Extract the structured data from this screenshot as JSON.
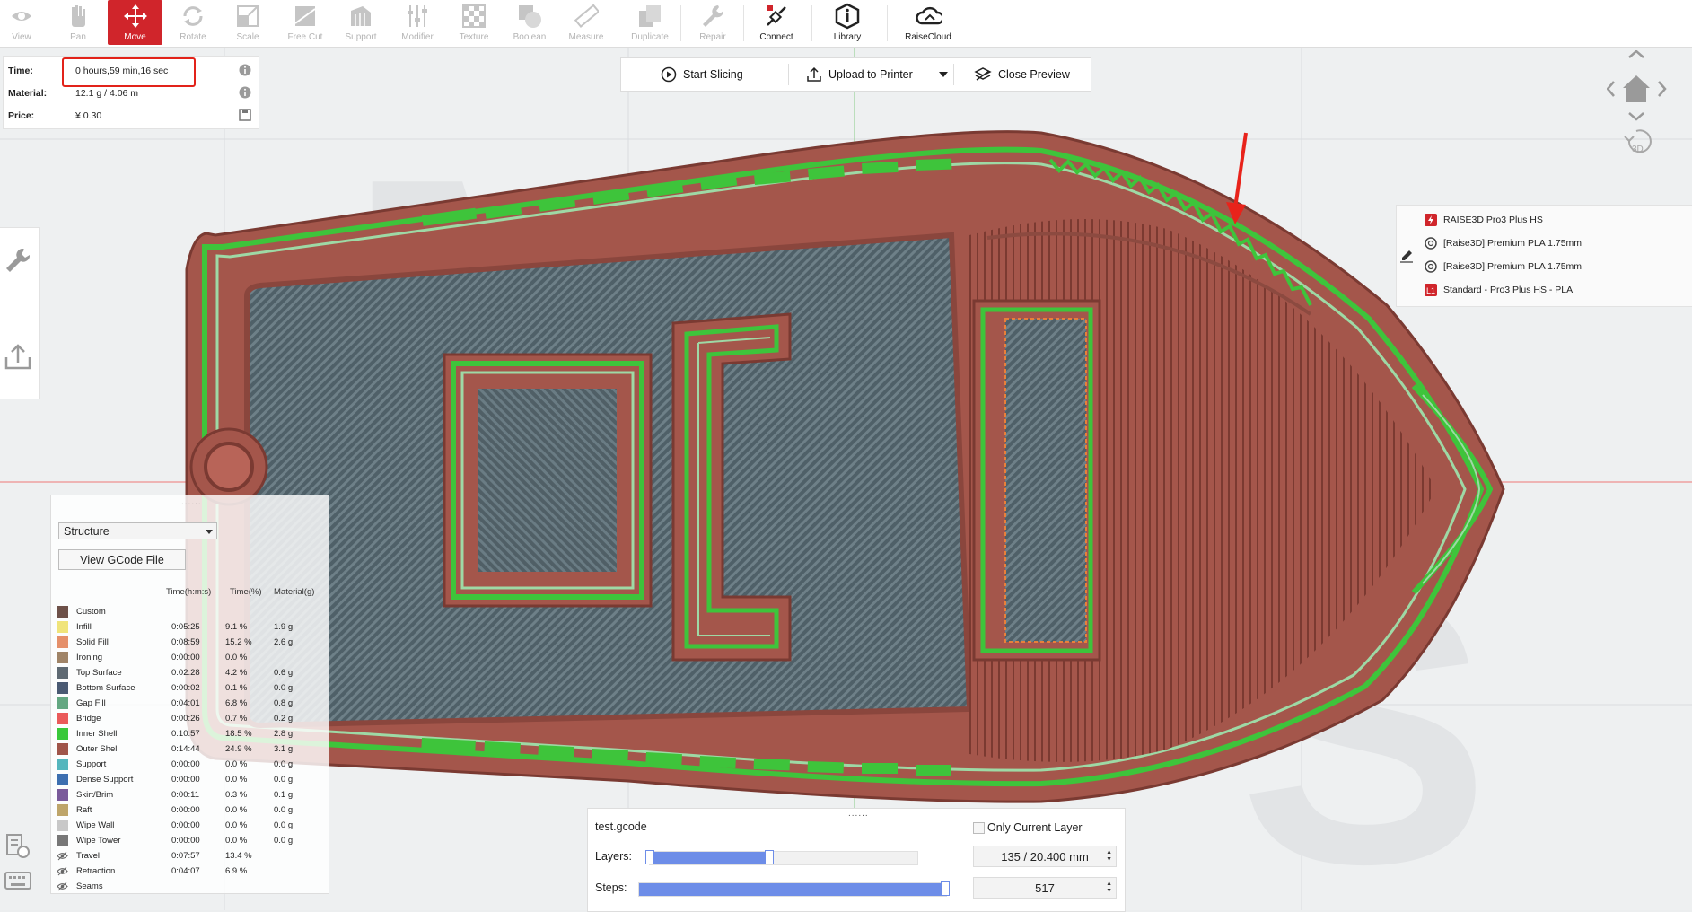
{
  "toolbar": {
    "items": [
      {
        "label": "View",
        "icon": "eye-icon"
      },
      {
        "label": "Pan",
        "icon": "hand-icon"
      },
      {
        "label": "Move",
        "icon": "move-icon"
      },
      {
        "label": "Rotate",
        "icon": "rotate-icon"
      },
      {
        "label": "Scale",
        "icon": "scale-icon"
      },
      {
        "label": "Free Cut",
        "icon": "free-cut-icon"
      },
      {
        "label": "Support",
        "icon": "support-icon"
      },
      {
        "label": "Modifier",
        "icon": "modifier-icon"
      },
      {
        "label": "Texture",
        "icon": "texture-icon"
      },
      {
        "label": "Boolean",
        "icon": "boolean-icon"
      },
      {
        "label": "Measure",
        "icon": "measure-icon"
      },
      {
        "label": "Duplicate",
        "icon": "duplicate-icon"
      },
      {
        "label": "Repair",
        "icon": "repair-icon"
      },
      {
        "label": "Connect",
        "icon": "connect-icon"
      },
      {
        "label": "Library",
        "icon": "library-icon"
      },
      {
        "label": "RaiseCloud",
        "icon": "cloud-icon"
      }
    ],
    "active": "Move",
    "active_color": "#d0252b"
  },
  "info": {
    "time_label": "Time:",
    "time_value": "0 hours,59 min,16 sec",
    "material_label": "Material:",
    "material_value": "12.1 g / 4.06 m",
    "price_label": "Price:",
    "price_value": "¥ 0.30"
  },
  "actions": {
    "start_slicing": "Start Slicing",
    "upload": "Upload to Printer",
    "close_preview": "Close Preview"
  },
  "machine": {
    "printer": "RAISE3D Pro3 Plus HS",
    "filament_left": "[Raise3D] Premium PLA 1.75mm",
    "filament_right": "[Raise3D] Premium PLA 1.75mm",
    "profile": "Standard - Pro3 Plus HS - PLA",
    "profile_badge": "L1"
  },
  "view_nav": {
    "badge": "3D"
  },
  "structure": {
    "mode": "Structure",
    "view_gcode": "View GCode File",
    "headers": {
      "time": "Time(h:m:s)",
      "pct": "Time(%)",
      "mat": "Material(g)"
    },
    "rows": [
      {
        "name": "Custom",
        "color": "#6e5149",
        "time": "",
        "pct": "",
        "mat": "",
        "eye": false
      },
      {
        "name": "Infill",
        "color": "#f0e47a",
        "time": "0:05:25",
        "pct": "9.1 %",
        "mat": "1.9 g",
        "eye": false
      },
      {
        "name": "Solid Fill",
        "color": "#e5906a",
        "time": "0:08:59",
        "pct": "15.2 %",
        "mat": "2.6 g",
        "eye": false
      },
      {
        "name": "Ironing",
        "color": "#a08467",
        "time": "0:00:00",
        "pct": "0.0 %",
        "mat": "",
        "eye": false
      },
      {
        "name": "Top Surface",
        "color": "#5f6a73",
        "time": "0:02:28",
        "pct": "4.2 %",
        "mat": "0.6 g",
        "eye": false
      },
      {
        "name": "Bottom Surface",
        "color": "#4a5a73",
        "time": "0:00:02",
        "pct": "0.1 %",
        "mat": "0.0 g",
        "eye": false
      },
      {
        "name": "Gap Fill",
        "color": "#64a882",
        "time": "0:04:01",
        "pct": "6.8 %",
        "mat": "0.8 g",
        "eye": false
      },
      {
        "name": "Bridge",
        "color": "#ea5a5a",
        "time": "0:00:26",
        "pct": "0.7 %",
        "mat": "0.2 g",
        "eye": false
      },
      {
        "name": "Inner Shell",
        "color": "#39c83a",
        "time": "0:10:57",
        "pct": "18.5 %",
        "mat": "2.8 g",
        "eye": false
      },
      {
        "name": "Outer Shell",
        "color": "#a0554a",
        "time": "0:14:44",
        "pct": "24.9 %",
        "mat": "3.1 g",
        "eye": false
      },
      {
        "name": "Support",
        "color": "#55b6bd",
        "time": "0:00:00",
        "pct": "0.0 %",
        "mat": "0.0 g",
        "eye": false
      },
      {
        "name": "Dense Support",
        "color": "#3d6fb0",
        "time": "0:00:00",
        "pct": "0.0 %",
        "mat": "0.0 g",
        "eye": false
      },
      {
        "name": "Skirt/Brim",
        "color": "#7a5a9a",
        "time": "0:00:11",
        "pct": "0.3 %",
        "mat": "0.1 g",
        "eye": false
      },
      {
        "name": "Raft",
        "color": "#bea56a",
        "time": "0:00:00",
        "pct": "0.0 %",
        "mat": "0.0 g",
        "eye": false
      },
      {
        "name": "Wipe Wall",
        "color": "#c8c8c8",
        "time": "0:00:00",
        "pct": "0.0 %",
        "mat": "0.0 g",
        "eye": false
      },
      {
        "name": "Wipe Tower",
        "color": "#777777",
        "time": "0:00:00",
        "pct": "0.0 %",
        "mat": "0.0 g",
        "eye": false
      },
      {
        "name": "Travel",
        "color": "",
        "time": "0:07:57",
        "pct": "13.4 %",
        "mat": "",
        "eye": true
      },
      {
        "name": "Retraction",
        "color": "",
        "time": "0:04:07",
        "pct": "6.9 %",
        "mat": "",
        "eye": true
      },
      {
        "name": "Seams",
        "color": "",
        "time": "",
        "pct": "",
        "mat": "",
        "eye": true
      }
    ]
  },
  "layers": {
    "file": "test.gcode",
    "only_current": "Only Current Layer",
    "layers_label": "Layers:",
    "layers_value": "135 / 20.400 mm",
    "layers_fraction": 0.45,
    "steps_label": "Steps:",
    "steps_value": "517",
    "steps_fraction": 1.0
  }
}
